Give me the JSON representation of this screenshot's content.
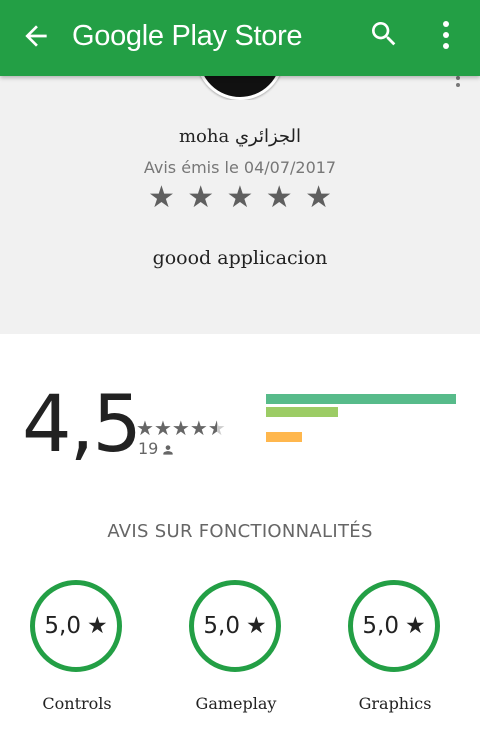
{
  "appbar": {
    "title": "Google Play Store",
    "back_icon": "arrow-back-icon",
    "search_icon": "search-icon",
    "more_icon": "more-vert-icon",
    "color": "#239f45"
  },
  "review": {
    "author": "moha الجزائري",
    "date": "Avis émis le 04/07/2017",
    "rating": 5,
    "text": "goood applicacion"
  },
  "summary": {
    "score": "4,5",
    "stars": "★★★★★",
    "rating_value": 4.5,
    "review_count": "19",
    "distribution": [
      {
        "stars": 5,
        "fraction": 1.0,
        "color": "#57bb8a"
      },
      {
        "stars": 4,
        "fraction": 0.38,
        "color": "#9ccc65"
      },
      {
        "stars": 3,
        "fraction": 0.0,
        "color": "#c0ca33"
      },
      {
        "stars": 2,
        "fraction": 0.19,
        "color": "#ffb74d"
      },
      {
        "stars": 1,
        "fraction": 0.0,
        "color": "#ff8a65"
      }
    ]
  },
  "features": {
    "title": "AVIS SUR FONCTIONNALITÉS",
    "items": [
      {
        "score": "5,0",
        "label": "Controls"
      },
      {
        "score": "5,0",
        "label": "Gameplay"
      },
      {
        "score": "5,0",
        "label": "Graphics"
      }
    ]
  }
}
